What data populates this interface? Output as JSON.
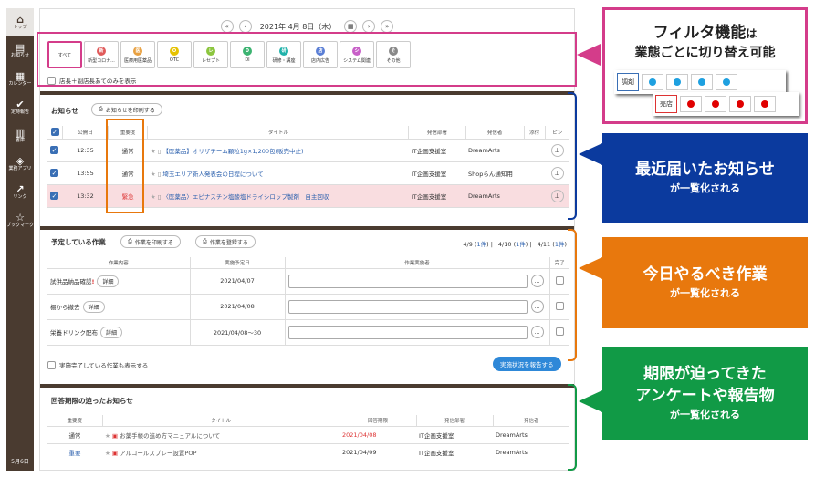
{
  "sidebar": {
    "items": [
      {
        "icon": "home-icon",
        "glyph": "⌂",
        "label": "トップ"
      },
      {
        "icon": "document-icon",
        "glyph": "▤",
        "label": "お知らせ"
      },
      {
        "icon": "calendar-icon",
        "glyph": "▦",
        "label": "カレンダー"
      },
      {
        "icon": "check-icon",
        "glyph": "✔",
        "label": "定時報告"
      },
      {
        "icon": "book-icon",
        "glyph": "▥",
        "label": "書庫"
      },
      {
        "icon": "layers-icon",
        "glyph": "◈",
        "label": "業務アプリ"
      },
      {
        "icon": "external-link-icon",
        "glyph": "↗",
        "label": "リンク"
      },
      {
        "icon": "star-icon",
        "glyph": "☆",
        "label": "ブックマーク"
      }
    ],
    "date": "5月6日"
  },
  "datebar": {
    "prev_fast": "«",
    "prev": "‹",
    "date": "2021年 4月 8日（木）",
    "calendar_icon": "▦",
    "next": "›",
    "next_fast": "»"
  },
  "filters": [
    {
      "label": "すべて",
      "mark": "",
      "color": ""
    },
    {
      "label": "新型コロナ...",
      "mark": "新",
      "color": "#e05a5a"
    },
    {
      "label": "医療用医薬品",
      "mark": "医",
      "color": "#e8a040"
    },
    {
      "label": "OTC",
      "mark": "O",
      "color": "#e6c200"
    },
    {
      "label": "レセプト",
      "mark": "レ",
      "color": "#8cc63f"
    },
    {
      "label": "DI",
      "mark": "D",
      "color": "#3cb371"
    },
    {
      "label": "研修・講座",
      "mark": "研",
      "color": "#20b2aa"
    },
    {
      "label": "店内広告",
      "mark": "店",
      "color": "#5b7fd6"
    },
    {
      "label": "システム関連",
      "mark": "シ",
      "color": "#c860c8"
    },
    {
      "label": "その他",
      "mark": "そ",
      "color": "#888888"
    }
  ],
  "filter_checkbox": "店長＋副店長あてのみを表示",
  "notices": {
    "title": "お知らせ",
    "print_button": "お知らせを印刷する",
    "headers": [
      "公開日",
      "重要度",
      "タイトル",
      "発信部署",
      "発信者",
      "添付",
      "ピン"
    ],
    "rows": [
      {
        "time": "12:35",
        "importance": "通常",
        "title": "【医薬品】オリザチーム顆粒1g×1,200包(販売中止)",
        "dept": "IT企画支援室",
        "sender": "DreamArts",
        "urgent": false
      },
      {
        "time": "13:55",
        "importance": "通常",
        "title": "埼玉エリア新人発表会の日程について",
        "dept": "IT企画支援室",
        "sender": "Shopらん通知用",
        "urgent": false
      },
      {
        "time": "13:32",
        "importance": "緊急",
        "title": "〈医薬品〉エピナスチン塩酸塩ドライシロップ製剤　自主回収",
        "dept": "IT企画支援室",
        "sender": "DreamArts",
        "urgent": true
      }
    ]
  },
  "tasks": {
    "title": "予定している作業",
    "print_button": "作業を印刷する",
    "register_button": "作業を登録する",
    "counts": [
      {
        "date": "4/9",
        "count": "1件"
      },
      {
        "date": "4/10",
        "count": "1件"
      },
      {
        "date": "4/11",
        "count": "1件"
      }
    ],
    "headers": [
      "作業内容",
      "実施予定日",
      "作業実施者",
      "完了"
    ],
    "rows": [
      {
        "name": "試供品納品確認",
        "alert": "!",
        "detail": "詳細",
        "date": "2021/04/07"
      },
      {
        "name": "棚から撤去",
        "alert": "",
        "detail": "詳細",
        "date": "2021/04/08"
      },
      {
        "name": "栄養ドリンク配布",
        "alert": "",
        "detail": "詳細",
        "date": "2021/04/08〜30"
      }
    ],
    "show_completed": "実施完了している作業も表示する",
    "report_button": "実施状況を報告する"
  },
  "deadline": {
    "title": "回答期限の迫ったお知らせ",
    "headers": [
      "重要度",
      "タイトル",
      "回答期限",
      "発信部署",
      "発信者"
    ],
    "rows": [
      {
        "importance": "通常",
        "title": "お薬手帳の進め方マニュアルについて",
        "due": "2021/04/08",
        "dept": "IT企画支援室",
        "sender": "DreamArts",
        "due_red": true
      },
      {
        "importance": "重要",
        "title": "アルコールスプレー設置POP",
        "due": "2021/04/09",
        "dept": "IT企画支援室",
        "sender": "DreamArts",
        "due_red": false
      }
    ]
  },
  "callouts": {
    "filter": {
      "line1a": "フィルタ機能",
      "line1b": "は",
      "line2": "業態ごとに切り替え可能",
      "card1": "調剤",
      "card2": "売店"
    },
    "notices": {
      "big": "最近届いたお知らせ",
      "small": "が一覧化される",
      "color": "#0b3a9e"
    },
    "tasks": {
      "big": "今日やるべき作業",
      "small": "が一覧化される",
      "color": "#e8780d"
    },
    "deadline": {
      "big1": "期限が迫ってきた",
      "big2": "アンケートや報告物",
      "small": "が一覧化される",
      "color": "#119a46"
    }
  }
}
